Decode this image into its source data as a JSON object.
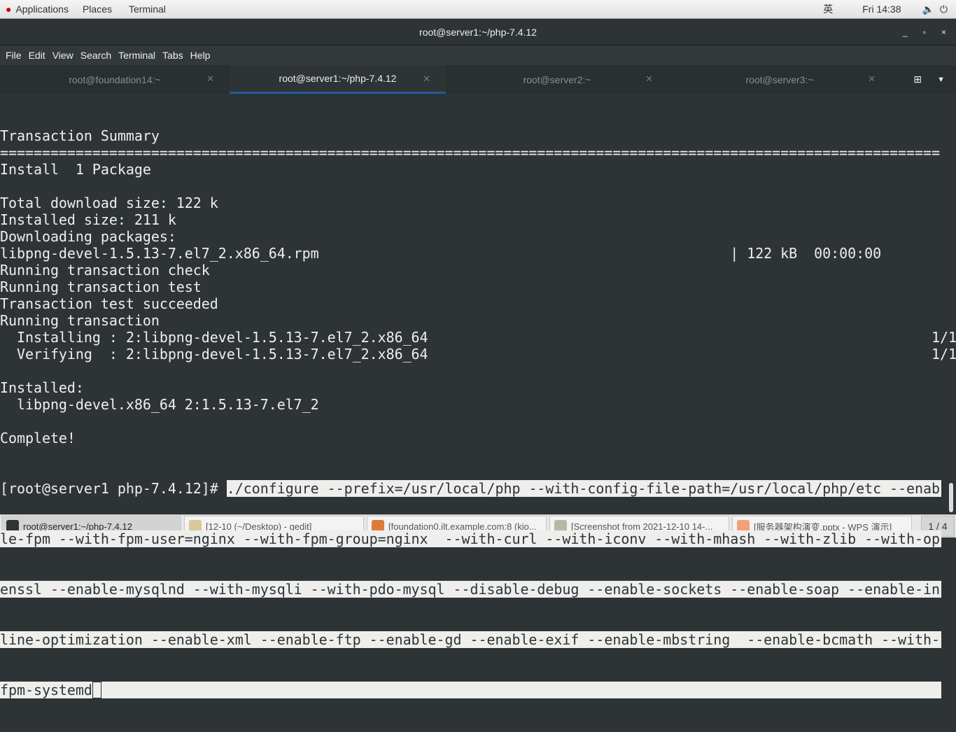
{
  "topbar": {
    "menus": [
      "Applications",
      "Places",
      "Terminal"
    ],
    "input_method": "英",
    "clock": "Fri 14:38"
  },
  "window": {
    "title": "root@server1:~/php-7.4.12",
    "minimize": "_",
    "maximize": "▫",
    "close": "×"
  },
  "menubar": [
    "File",
    "Edit",
    "View",
    "Search",
    "Terminal",
    "Tabs",
    "Help"
  ],
  "tabs": [
    {
      "label": "root@foundation14:~",
      "active": false
    },
    {
      "label": "root@server1:~/php-7.4.12",
      "active": true
    },
    {
      "label": "root@server2:~",
      "active": false
    },
    {
      "label": "root@server3:~",
      "active": false
    }
  ],
  "terminal": {
    "lines": [
      "Transaction Summary",
      "================================================================================================================",
      "Install  1 Package",
      "",
      "Total download size: 122 k",
      "Installed size: 211 k",
      "Downloading packages:",
      "libpng-devel-1.5.13-7.el7_2.x86_64.rpm                                                 | 122 kB  00:00:00",
      "Running transaction check",
      "Running transaction test",
      "Transaction test succeeded",
      "Running transaction",
      "  Installing : 2:libpng-devel-1.5.13-7.el7_2.x86_64                                                            1/1",
      "  Verifying  : 2:libpng-devel-1.5.13-7.el7_2.x86_64                                                            1/1",
      "",
      "Installed:",
      "  libpng-devel.x86_64 2:1.5.13-7.el7_2",
      "",
      "Complete!"
    ],
    "prompt": "[root@server1 php-7.4.12]# ",
    "command_lines": [
      "./configure --prefix=/usr/local/php --with-config-file-path=/usr/local/php/etc --enab",
      "le-fpm --with-fpm-user=nginx --with-fpm-group=nginx  --with-curl --with-iconv --with-mhash --with-zlib --with-op",
      "enssl --enable-mysqlnd --with-mysqli --with-pdo-mysql --disable-debug --enable-sockets --enable-soap --enable-in",
      "line-optimization --enable-xml --enable-ftp --enable-gd --enable-exif --enable-mbstring  --enable-bcmath --with-",
      "fpm-systemd"
    ]
  },
  "taskbar": {
    "tasks": [
      {
        "label": "root@server1:~/php-7.4.12",
        "icon": "terminal-icon",
        "color": "#2e3436"
      },
      {
        "label": "[12-10 (~/Desktop) - gedit]",
        "icon": "gedit-icon",
        "color": "#d8c89a"
      },
      {
        "label": "[foundation0.ilt.example.com:8 (kio...",
        "icon": "viewer-icon",
        "color": "#e07a3a"
      },
      {
        "label": "[Screenshot from 2021-12-10 14-...",
        "icon": "image-viewer-icon",
        "color": "#b9b9a0"
      },
      {
        "label": "[服务器架构演变.pptx - WPS 演示]",
        "icon": "wps-icon",
        "color": "#f5a07a"
      }
    ],
    "pager": "1 / 4"
  }
}
